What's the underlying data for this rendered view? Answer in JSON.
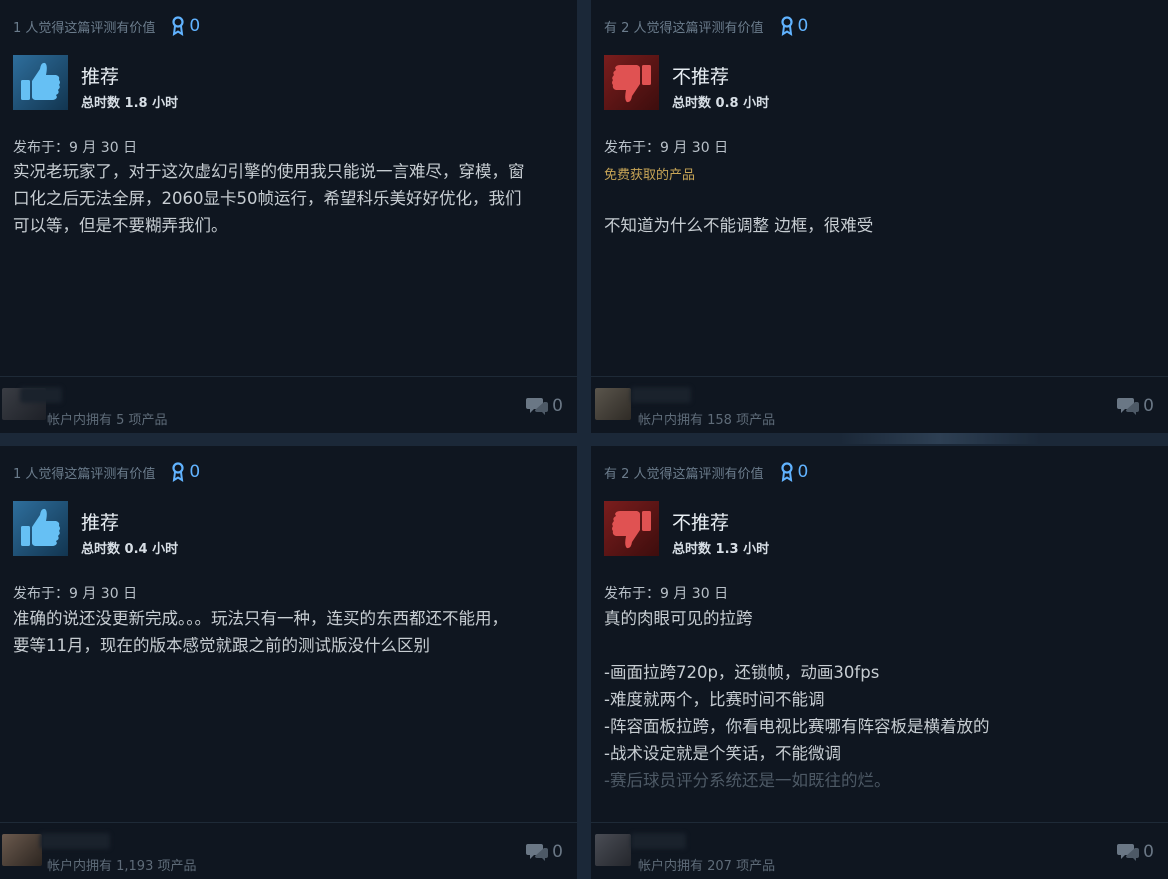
{
  "reviews": [
    {
      "helpful_text": "1 人觉得这篇评测有价值",
      "award_count": "0",
      "recommended": true,
      "verdict": "推荐",
      "hours": "总时数 1.8 小时",
      "posted": "发布于：9 月 30 日",
      "free_label": "",
      "body": [
        "实况老玩家了，对于这次虚幻引擎的使用我只能说一言难尽，穿模，窗",
        "口化之后无法全屏，2060显卡50帧运行，希望科乐美好好优化，我们",
        "可以等，但是不要糊弄我们。"
      ],
      "owned": "帐户内拥有 5 项产品",
      "comment_count": "0"
    },
    {
      "helpful_text": "有 2 人觉得这篇评测有价值",
      "award_count": "0",
      "recommended": false,
      "verdict": "不推荐",
      "hours": "总时数 0.8 小时",
      "posted": "发布于：9 月 30 日",
      "free_label": "免费获取的产品",
      "body": [
        "不知道为什么不能调整 边框，很难受"
      ],
      "owned": "帐户内拥有 158 项产品",
      "comment_count": "0"
    },
    {
      "helpful_text": "1 人觉得这篇评测有价值",
      "award_count": "0",
      "recommended": true,
      "verdict": "推荐",
      "hours": "总时数 0.4 小时",
      "posted": "发布于：9 月 30 日",
      "free_label": "",
      "body": [
        "准确的说还没更新完成。。。玩法只有一种，连买的东西都还不能用，",
        "要等11月，现在的版本感觉就跟之前的测试版没什么区别"
      ],
      "owned": "帐户内拥有 1,193 项产品",
      "comment_count": "0"
    },
    {
      "helpful_text": "有 2 人觉得这篇评测有价值",
      "award_count": "0",
      "recommended": false,
      "verdict": "不推荐",
      "hours": "总时数 1.3 小时",
      "posted": "发布于：9 月 30 日",
      "free_label": "",
      "body": [
        "真的肉眼可见的拉跨",
        "",
        "-画面拉跨720p，还锁帧，动画30fps",
        "-难度就两个，比赛时间不能调",
        "-阵容面板拉跨，你看电视比赛哪有阵容板是横着放的",
        "-战术设定就是个笑话，不能微调",
        "-赛后球员评分系统还是一如既往的烂。"
      ],
      "owned": "帐户内拥有 207 项产品",
      "comment_count": "0"
    }
  ],
  "colors": {
    "recommend": "#66c0f4",
    "not_recommend": "#c23b3b",
    "award": "#61b3ff"
  },
  "icons": {
    "award": "award-ribbon-icon",
    "thumb_up": "thumbs-up-icon",
    "thumb_down": "thumbs-down-icon",
    "comment": "comment-bubble-icon"
  }
}
